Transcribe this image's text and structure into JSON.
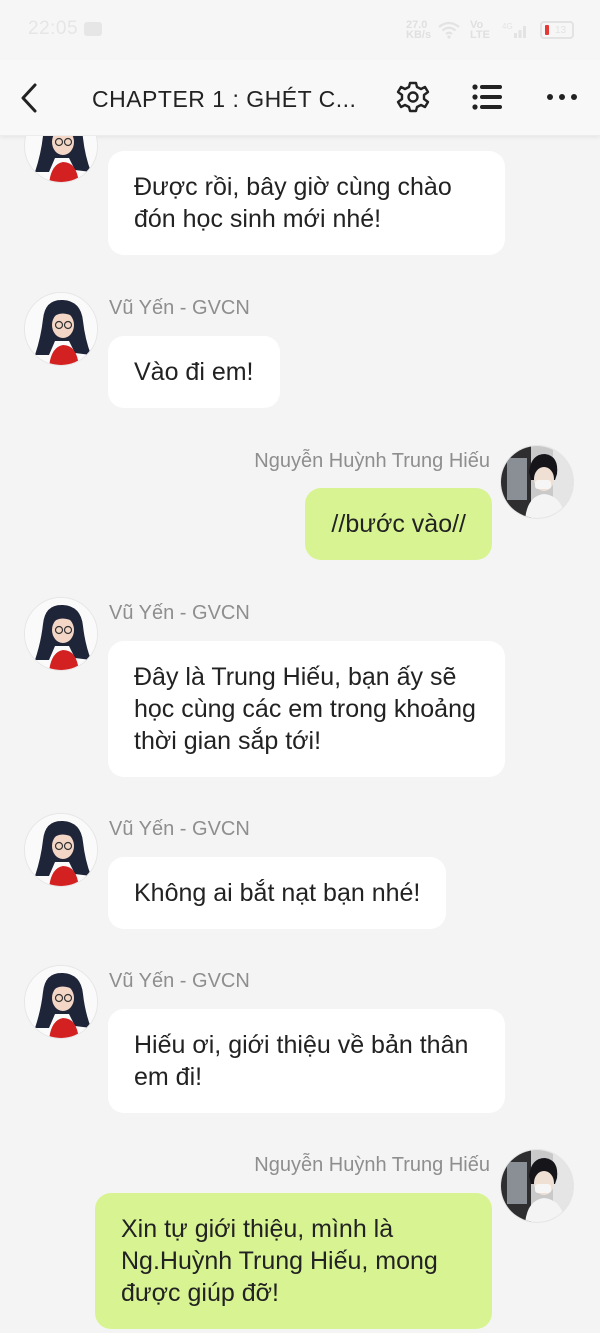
{
  "status_bar": {
    "time": "22:05",
    "network_speed": "27.0 KB/s",
    "volte": "Vo LTE",
    "signal_type": "4G",
    "battery_percent": "13"
  },
  "header": {
    "title": "CHAPTER 1 : GHÉT C...",
    "back_icon": "back-arrow-icon",
    "settings_icon": "gear-icon",
    "toc_icon": "list-icon",
    "more_icon": "more-dots-icon"
  },
  "characters": {
    "teacher": {
      "name": "Vũ Yến - GVCN",
      "avatar_icon": "teacher-avatar"
    },
    "student": {
      "name": "Nguyễn Huỳnh Trung Hiếu",
      "avatar_icon": "student-avatar"
    }
  },
  "messages": [
    {
      "sender": "teacher",
      "text": "Được rồi, bây giờ cùng chào đón học sinh mới nhé!",
      "name_visible": false
    },
    {
      "sender": "teacher",
      "text": "Vào đi em!",
      "name_visible": true
    },
    {
      "sender": "student",
      "text": "//bước vào//",
      "name_visible": true
    },
    {
      "sender": "teacher",
      "text": "Đây là Trung Hiếu, bạn ấy sẽ học cùng các em trong khoảng thời gian sắp tới!",
      "name_visible": true
    },
    {
      "sender": "teacher",
      "text": "Không ai bắt nạt bạn nhé!",
      "name_visible": true
    },
    {
      "sender": "teacher",
      "text": "Hiếu ơi, giới thiệu về bản thân em đi!",
      "name_visible": true
    },
    {
      "sender": "student",
      "text": "Xin tự giới thiệu, mình là Ng.Huỳnh Trung Hiếu, mong được giúp đỡ!",
      "name_visible": true
    }
  ],
  "colors": {
    "left_bubble": "#ffffff",
    "right_bubble": "#d8f492",
    "background": "#f4f4f4",
    "name_text": "#8e8e8e"
  }
}
